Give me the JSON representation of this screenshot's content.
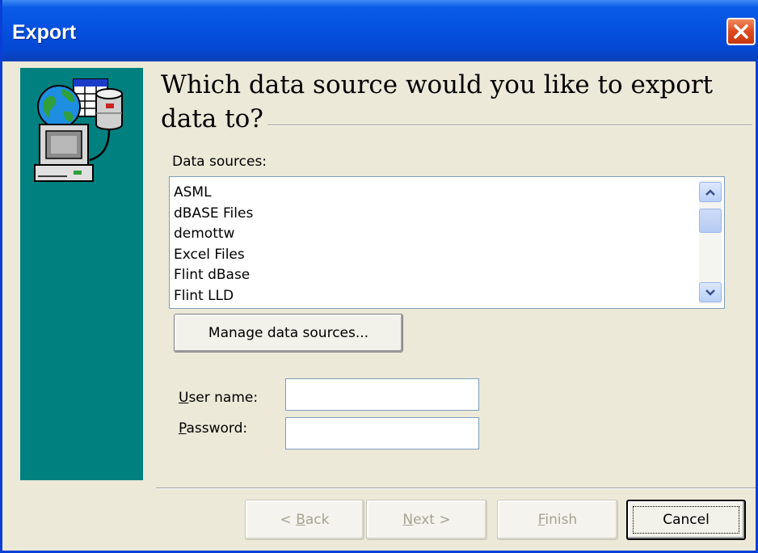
{
  "window": {
    "title": "Export"
  },
  "heading": "Which data source would you like to export data to?",
  "data_sources": {
    "label": "Data sources:",
    "items": [
      "ASML",
      "dBASE Files",
      "demottw",
      "Excel Files",
      "Flint dBase",
      "Flint LLD"
    ]
  },
  "manage_button": "Manage data sources...",
  "credentials": {
    "user_label_accel": "U",
    "user_label_rest": "ser name:",
    "user_value": "",
    "password_label_accel": "P",
    "password_label_rest": "assword:",
    "password_value": ""
  },
  "buttons": {
    "back_pre": "< ",
    "back_accel": "B",
    "back_rest": "ack",
    "next_accel": "N",
    "next_rest": "ext >",
    "finish_accel": "F",
    "finish_rest": "inish",
    "cancel": "Cancel"
  },
  "colors": {
    "titlebar": "#0551e0",
    "sidepanel": "#00807f",
    "dialog_bg": "#ece9d8"
  },
  "icons": {
    "sidepanel": "computer-network-database-icon",
    "close": "close-icon"
  }
}
